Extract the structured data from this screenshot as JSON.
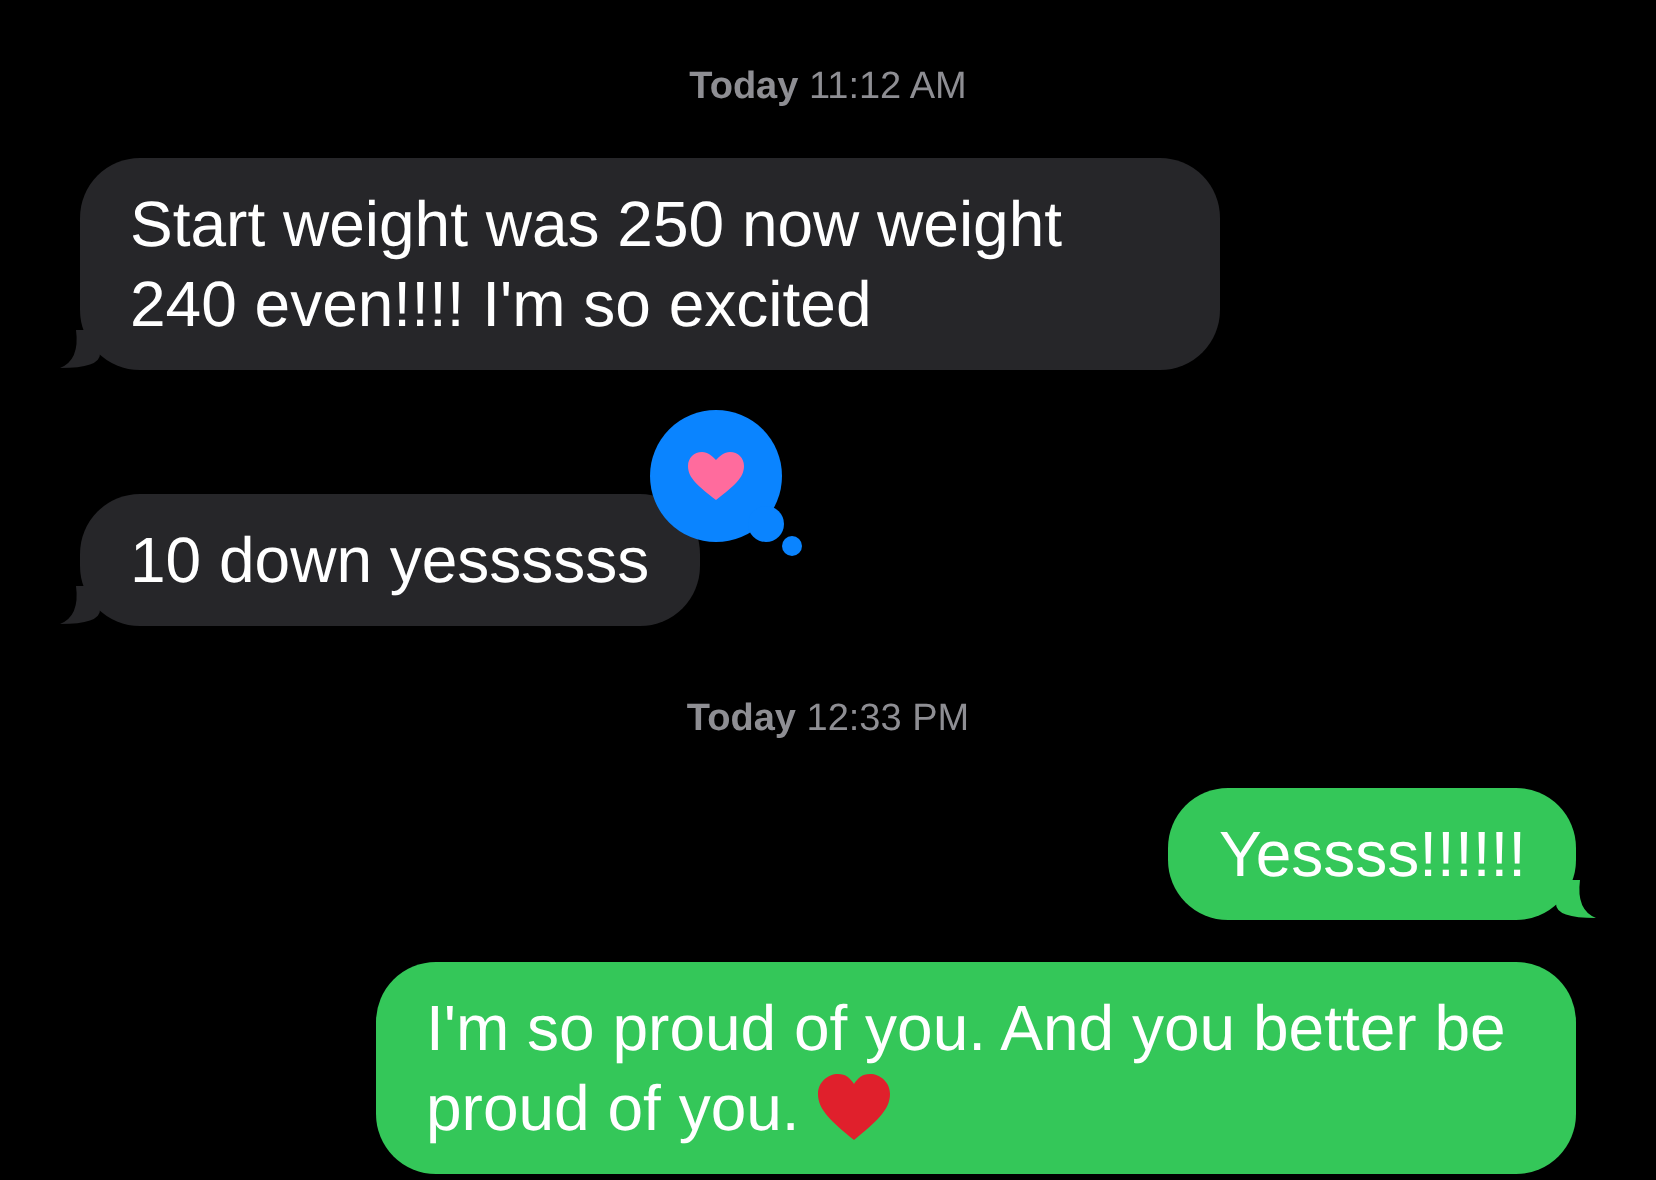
{
  "messages": [
    {
      "kind": "timestamp",
      "text": "**Today** 11:12 AM"
    },
    {
      "kind": "incoming",
      "text": "Start weight was 250 now weight 240 even!!!! I'm so excited",
      "reacted": false,
      "tail": true
    },
    {
      "kind": "incoming",
      "text": "10 down yessssss",
      "reacted": true,
      "tail": true
    },
    {
      "kind": "timestamp",
      "text": "**Today** 12:33 PM"
    },
    {
      "kind": "outgoing",
      "text": "Yessss!!!!!!",
      "heart": false,
      "tail": true
    },
    {
      "kind": "outgoing",
      "text": "I'm so proud of you. And you better be proud of you.",
      "heart": true,
      "tail": false
    }
  ]
}
